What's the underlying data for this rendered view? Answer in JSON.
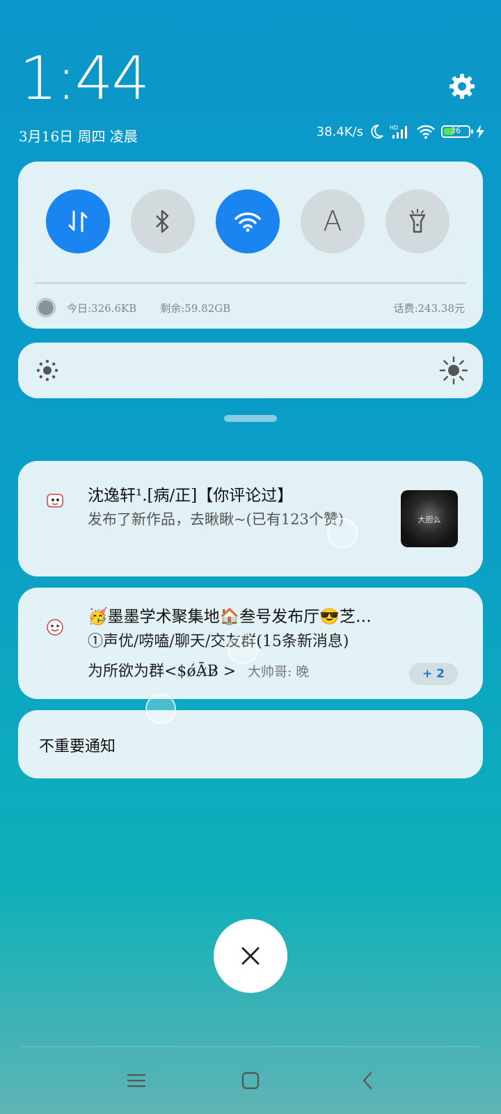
{
  "status": {
    "time": "1:44",
    "date": "3月16日 周四 凌晨",
    "net_speed": "38.4K/s",
    "battery_level": "36"
  },
  "quick_settings": {
    "toggles": [
      {
        "name": "mobile-data",
        "on": true
      },
      {
        "name": "bluetooth",
        "on": false
      },
      {
        "name": "wifi",
        "on": true
      },
      {
        "name": "auto-brightness",
        "label": "A",
        "on": false
      },
      {
        "name": "flashlight",
        "on": false
      }
    ],
    "data_today": "今日:326.6KB",
    "data_remaining": "剩余:59.82GB",
    "balance": "话费:243.38元"
  },
  "notifications": [
    {
      "title": "沈逸轩¹.[病/正]【你评论过】",
      "body": "发布了新作品，去瞅瞅~(已有123个赞)",
      "thumb_text": "大胆么"
    },
    {
      "title": "🥳墨墨学术聚集地🏠叁号发布厅😎芝…",
      "body_line1": "①声优/唠嗑/聊天/交友群(15条新消息)",
      "body_line2_main": "为所欲为群<$ǿĀ̷B̷ >",
      "body_line2_sub": "大帅哥: 晚",
      "badge": "+ 2"
    },
    {
      "title": "不重要通知"
    }
  ],
  "colors": {
    "accent": "#1a84f0",
    "background_top": "#0b97c9",
    "background_bottom": "#5fb4b4"
  }
}
